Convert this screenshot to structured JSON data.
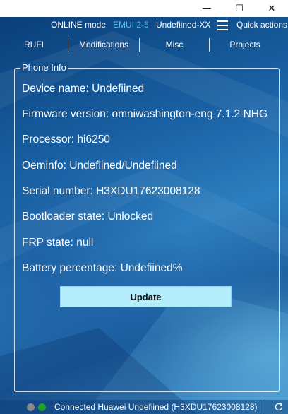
{
  "titlebar": {
    "minimize_glyph": "—",
    "maximize_glyph": "☐",
    "close_glyph": "✕"
  },
  "header": {
    "mode": "ONLINE mode",
    "emui": "EMUI 2-5",
    "model": "Undefiined-XX",
    "quick_actions": "Quick actions",
    "emui_color": "#4fc3f7"
  },
  "tabs": [
    "RUFI",
    "Modifications",
    "Misc",
    "Projects"
  ],
  "phone_info": {
    "legend": "Phone Info",
    "lines": [
      "Device name: Undefiined",
      "Firmware version: omniwashington-eng 7.1.2 NHG",
      "Processor: hi6250",
      "Oeminfo: Undefiined/Undefiined",
      "Serial number: H3XDU17623008128",
      "Bootloader state: Unlocked",
      "FRP state: null",
      "Battery percentage: Undefiined%"
    ],
    "update_label": "Update"
  },
  "statusbar": {
    "text": "Connected Huawei Undefiined (H3XDU17623008128)",
    "indicator_1_color": "#8a8a8a",
    "indicator_2_color": "#1fa32a",
    "refresh_icon": "refresh-icon"
  }
}
